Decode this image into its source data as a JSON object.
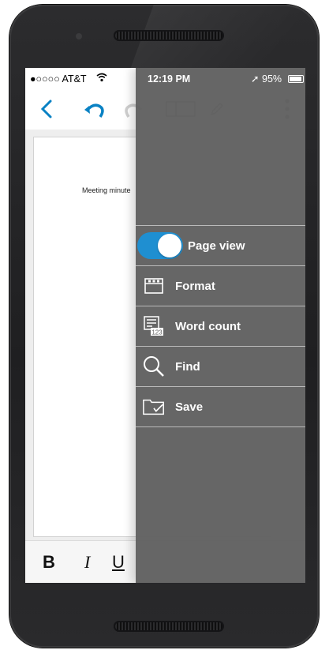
{
  "status_bar": {
    "carrier": "●○○○○ AT&T",
    "wifi_icon": "wifi-icon",
    "time": "12:19 PM",
    "location_icon": "location-arrow-icon",
    "battery": "95%"
  },
  "toolbar": {
    "back_icon": "chevron-left-icon",
    "undo_icon": "undo-icon",
    "redo_icon": "redo-icon",
    "layout_icon": "layout-icon",
    "edit_icon": "pencil-icon",
    "more_icon": "more-vertical-icon"
  },
  "document": {
    "visible_text": "Meeting minute"
  },
  "format_bar": {
    "bold": "B",
    "italic": "I",
    "underline": "U"
  },
  "menu": {
    "items": [
      {
        "label": "Page view",
        "type": "toggle",
        "on": true
      },
      {
        "label": "Format",
        "icon": "format-icon"
      },
      {
        "label": "Word count",
        "icon": "word-count-icon"
      },
      {
        "label": "Find",
        "icon": "search-icon"
      },
      {
        "label": "Save",
        "icon": "save-folder-icon"
      }
    ]
  },
  "colors": {
    "accent": "#1f8fd1",
    "drawer": "#606060"
  }
}
